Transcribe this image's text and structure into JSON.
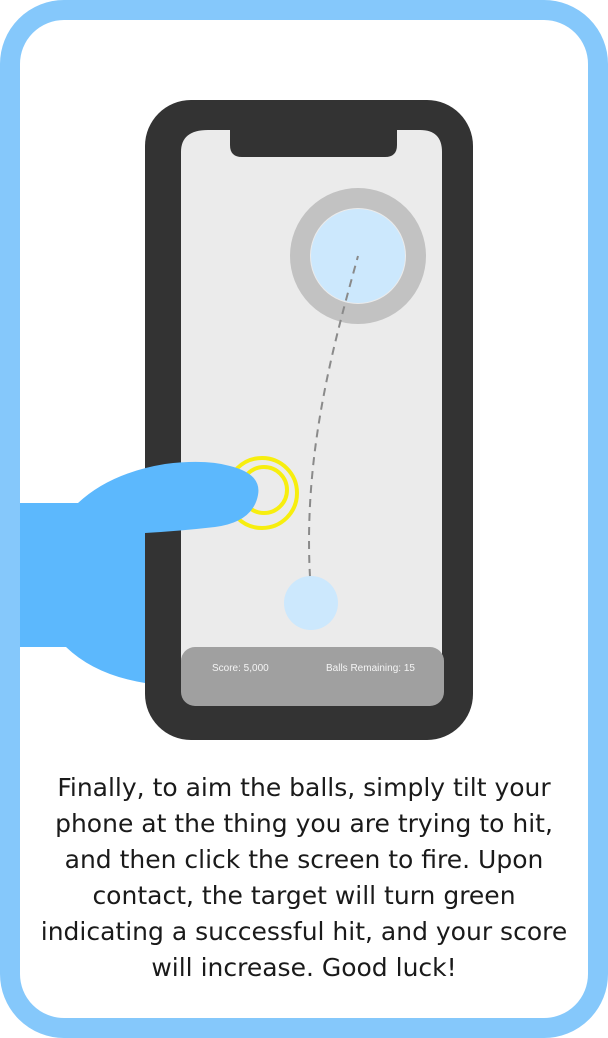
{
  "tutorial": {
    "instructions": "Finally, to aim the balls, simply tilt your phone at the thing you are trying to hit, and then click the screen to fire. Upon contact, the target will turn green indicating a successful hit, and your score will increase. Good luck!"
  },
  "hud": {
    "score_label": "Score: 5,000",
    "balls_label": "Balls Remaining: 15"
  },
  "colors": {
    "frame_border": "#85c8fb",
    "phone_body": "#333333",
    "screen": "#ebebeb",
    "target_ring": "#c2c2c2",
    "target_fill": "#cce8fd",
    "aim_ring": "#f7ee0e",
    "hand": "#5cb8fd",
    "hud_bar": "#a0a0a0"
  },
  "icons": {
    "hand": "pointing-hand-icon",
    "aim": "tap-ripple-icon"
  }
}
